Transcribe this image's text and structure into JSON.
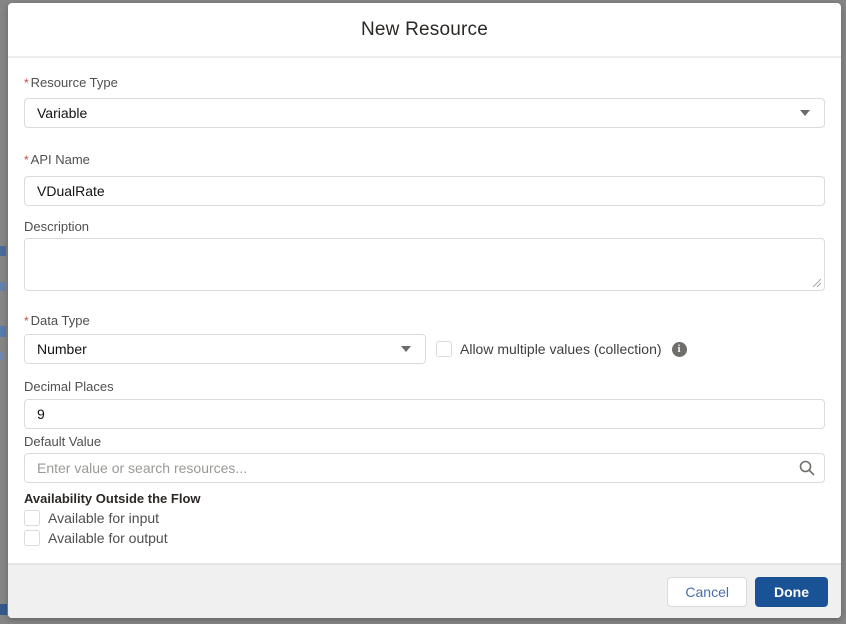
{
  "modal": {
    "title": "New Resource",
    "required_marker": "*",
    "fields": {
      "resource_type": {
        "label": "Resource Type",
        "value": "Variable"
      },
      "api_name": {
        "label": "API Name",
        "value": "VDualRate"
      },
      "description": {
        "label": "Description",
        "value": ""
      },
      "data_type": {
        "label": "Data Type",
        "value": "Number"
      },
      "collection_checkbox": {
        "label": "Allow multiple values (collection)"
      },
      "decimal_places": {
        "label": "Decimal Places",
        "value": "9"
      },
      "default_value": {
        "label": "Default Value",
        "placeholder": "Enter value or search resources..."
      }
    },
    "availability": {
      "heading": "Availability Outside the Flow",
      "options": [
        {
          "label": "Available for input"
        },
        {
          "label": "Available for output"
        }
      ]
    },
    "footer": {
      "cancel_label": "Cancel",
      "done_label": "Done"
    },
    "colors": {
      "accent_blue": "#1a5296",
      "required_red": "#cb4842",
      "border_gray": "#dddbda",
      "backdrop_gray": "#858585"
    }
  }
}
